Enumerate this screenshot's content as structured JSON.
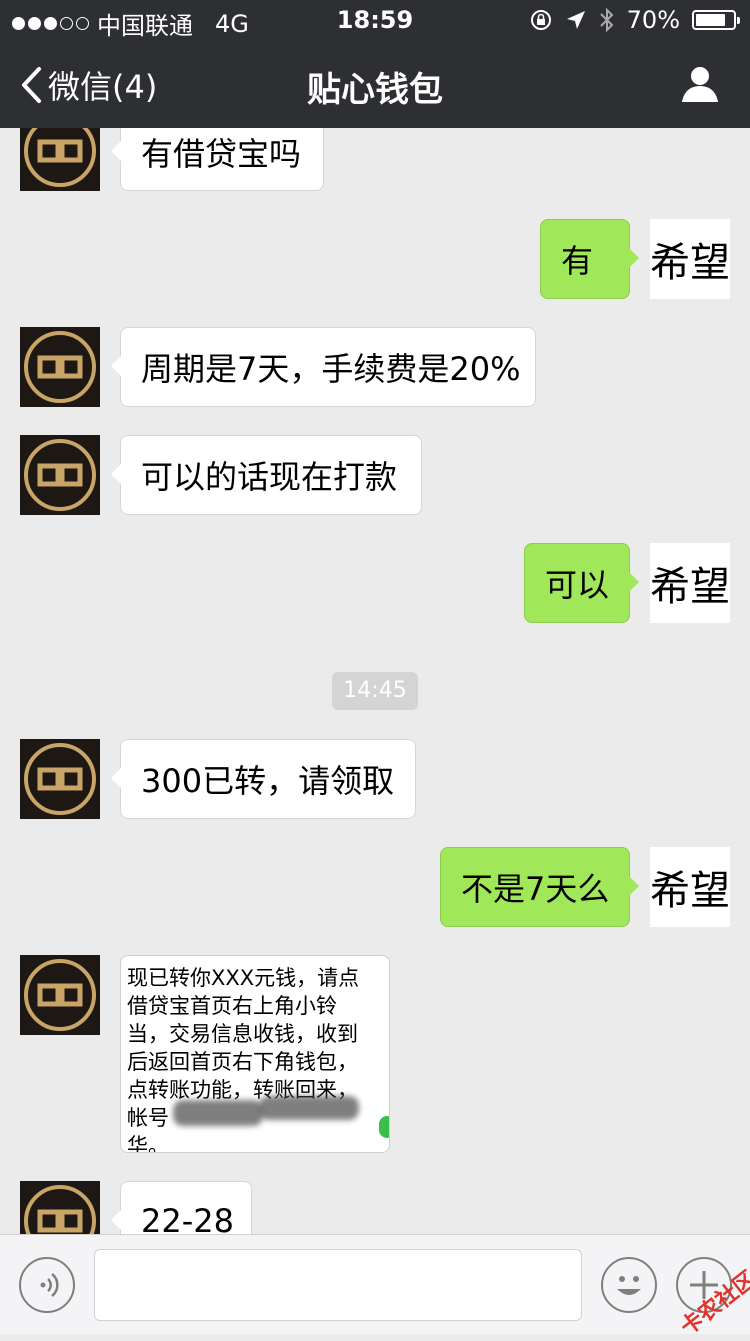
{
  "status_bar": {
    "carrier": "中国联通",
    "network": "4G",
    "time": "18:59",
    "battery": "70%",
    "battery_level": 0.7
  },
  "nav": {
    "back_label": "微信(4)",
    "title": "贴心钱包"
  },
  "messages": {
    "m1": "有借贷宝吗",
    "m2": "有",
    "m3": "周期是7天，手续费是20%",
    "m4": "可以的话现在打款",
    "m5": "可以",
    "timestamp": "14:45",
    "m6": "300已转，请领取",
    "m7": "不是7天么",
    "m8_lines": [
      "现已转你XXX元钱，请点",
      "借贷宝首页右上角小铃",
      "当，交易信息收钱，收到",
      "后返回首页右下角钱包，",
      "点转账功能，转账回来，",
      "帐号",
      "华。"
    ],
    "m9": "22-28"
  },
  "self_avatar_text": "希望",
  "input": {
    "value": ""
  },
  "watermark": "卡农社区",
  "colors": {
    "nav_bg": "#2e2f33",
    "chat_bg": "#ebebeb",
    "green_bubble": "#a0e759",
    "white_bubble": "#ffffff"
  }
}
